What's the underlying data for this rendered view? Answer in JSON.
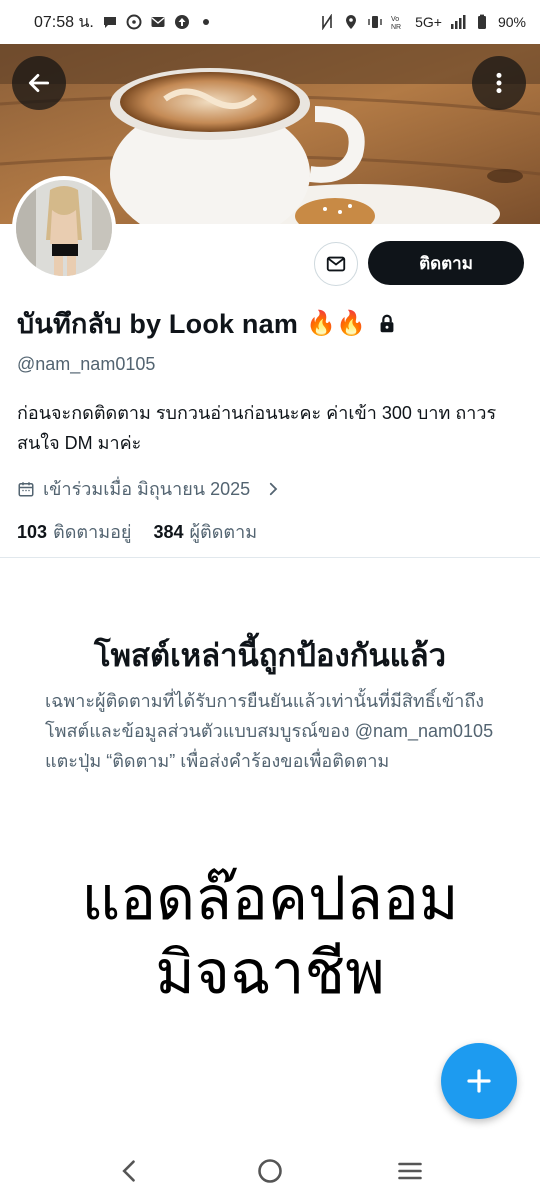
{
  "status_bar": {
    "time": "07:58 น.",
    "battery": "90%",
    "network": "5G+"
  },
  "profile": {
    "display_name": "บันทึกลับ by Look nam",
    "emoji": "🔥🔥",
    "handle": "@nam_nam0105",
    "bio": "ก่อนจะกดติดตาม รบกวนอ่านก่อนนะคะ ค่าเข้า 300 บาท ถาวร สนใจ DM มาค่ะ",
    "joined": "เข้าร่วมเมื่อ มิถุนายน 2025",
    "following_count": "103",
    "following_label": "ติดตามอยู่",
    "followers_count": "384",
    "followers_label": "ผู้ติดตาม"
  },
  "actions": {
    "follow_label": "ติดตาม"
  },
  "protected": {
    "title": "โพสต์เหล่านี้ถูกป้องกันแล้ว",
    "body": "เฉพาะผู้ติดตามที่ได้รับการยืนยันแล้วเท่านั้นที่มีสิทธิ์เข้าถึงโพสต์และข้อมูลส่วนตัวแบบสมบูรณ์ของ @nam_nam0105 แตะปุ่ม “ติดตาม” เพื่อส่งคำร้องขอเพื่อติดตาม"
  },
  "overlay": {
    "line1": "แอดล๊อคปลอม",
    "line2": "มิจฉาชีพ"
  },
  "icons": {
    "back": "back-arrow-icon",
    "more": "more-vertical-icon",
    "message": "envelope-icon",
    "lock": "lock-icon",
    "calendar": "calendar-icon",
    "chevron": "chevron-right-icon",
    "compose": "plus-icon"
  },
  "colors": {
    "accent": "#1d9bf0",
    "follow_button": "#0f1419",
    "secondary_text": "#536471"
  }
}
